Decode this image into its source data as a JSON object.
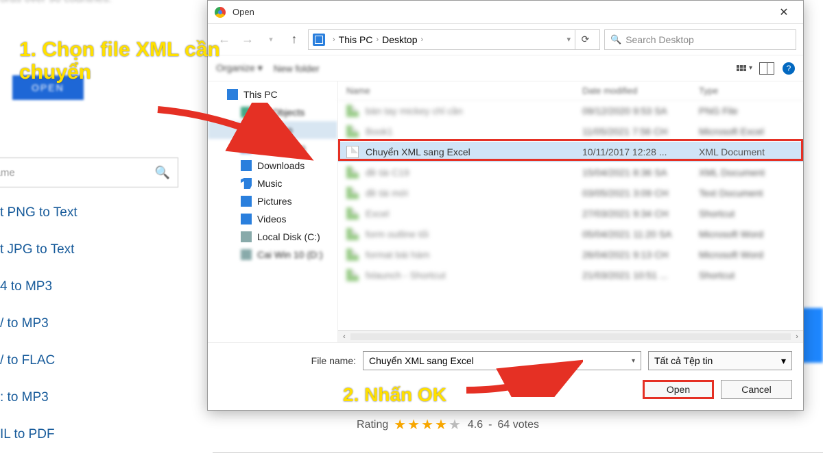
{
  "bg": {
    "partial_top": "ords over 90 countries.",
    "open_btn": "OPEN",
    "search_placeholder": "r name",
    "links": [
      "t PNG to Text",
      "t JPG to Text",
      "4 to MP3",
      "/ to MP3",
      "/ to FLAC",
      ": to MP3",
      "IL to PDF"
    ]
  },
  "dialog": {
    "title": "Open",
    "breadcrumb": {
      "root": "This PC",
      "folder": "Desktop"
    },
    "search_placeholder": "Search Desktop",
    "toolbar": {
      "organize": "Organize ▾",
      "newfolder": "New folder"
    },
    "tree": [
      {
        "label": "This PC",
        "icon": "ico-pc",
        "sel": false,
        "sub": false,
        "blur": false
      },
      {
        "label": "3D Objects",
        "icon": "ico-3d",
        "sel": false,
        "sub": true,
        "blur": true
      },
      {
        "label": "Desktop",
        "icon": "ico-desk",
        "sel": true,
        "sub": true,
        "blur": true
      },
      {
        "label": "Documents",
        "icon": "ico-docs",
        "sel": false,
        "sub": true,
        "blur": true
      },
      {
        "label": "Downloads",
        "icon": "ico-dl",
        "sel": false,
        "sub": true,
        "blur": false
      },
      {
        "label": "Music",
        "icon": "ico-music",
        "sel": false,
        "sub": true,
        "blur": false
      },
      {
        "label": "Pictures",
        "icon": "ico-pic",
        "sel": false,
        "sub": true,
        "blur": false
      },
      {
        "label": "Videos",
        "icon": "ico-vid",
        "sel": false,
        "sub": true,
        "blur": false
      },
      {
        "label": "Local Disk (C:)",
        "icon": "ico-disk",
        "sel": false,
        "sub": true,
        "blur": false
      },
      {
        "label": "Cai Win 10 (D:)",
        "icon": "ico-disk",
        "sel": false,
        "sub": true,
        "blur": true
      }
    ],
    "headers": {
      "name": "Name",
      "date": "Date modified",
      "type": "Type"
    },
    "files": [
      {
        "name": "bàn tay mickey chỉ cần",
        "date": "09/12/2020 9:53 SA",
        "type": "PNG File",
        "blur": true,
        "sel": false
      },
      {
        "name": "Book1",
        "date": "11/05/2021 7:56 CH",
        "type": "Microsoft Excel",
        "blur": true,
        "sel": false
      },
      {
        "name": "Chuyển XML sang Excel",
        "date": "10/11/2017 12:28 ...",
        "type": "XML Document",
        "blur": false,
        "sel": true
      },
      {
        "name": "đề tài C19",
        "date": "15/04/2021 8:36 SA",
        "type": "XML Document",
        "blur": true,
        "sel": false
      },
      {
        "name": "đề tài mới",
        "date": "03/05/2021 3:09 CH",
        "type": "Text Document",
        "blur": true,
        "sel": false
      },
      {
        "name": "Excel",
        "date": "27/03/2021 9:34 CH",
        "type": "Shortcut",
        "blur": true,
        "sel": false
      },
      {
        "name": "form outline tối",
        "date": "05/04/2021 11:20 SA",
        "type": "Microsoft Word",
        "blur": true,
        "sel": false
      },
      {
        "name": "format bài hàm",
        "date": "26/04/2021 9:13 CH",
        "type": "Microsoft Word",
        "blur": true,
        "sel": false
      },
      {
        "name": "fxlaunch - Shortcut",
        "date": "21/03/2021 10:51 ...",
        "type": "Shortcut",
        "blur": true,
        "sel": false
      }
    ],
    "filename_label": "File name:",
    "filename_value": "Chuyển XML sang Excel",
    "filter": "Tất cả Tệp tin",
    "open_btn": "Open",
    "cancel_btn": "Cancel"
  },
  "rating": {
    "label": "Rating",
    "value": "4.6",
    "count": "64 votes"
  },
  "annotations": {
    "step1": "1. Chọn file XML cần chuyển",
    "step2": "2. Nhấn OK"
  }
}
